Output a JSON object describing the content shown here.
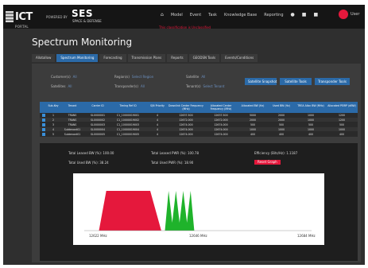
{
  "header": {
    "brand": "ICT",
    "brand_sub": "PORTAL",
    "powered_by": "POWERED BY",
    "ses": "SES",
    "ses_sub": "SPACE & DEFENSE",
    "nav": [
      {
        "label": "Home"
      },
      {
        "label": "Model"
      },
      {
        "label": "Event"
      },
      {
        "label": "Task"
      },
      {
        "label": "Knowledge Base"
      },
      {
        "label": "Reporting"
      }
    ],
    "user_label": "User",
    "banner": "This classification is Unclassified"
  },
  "page": {
    "title": "Spectrum Monitoring",
    "tabs": [
      {
        "label": "Allotallow"
      },
      {
        "label": "Spectrum Monitoring"
      },
      {
        "label": "Forecasting"
      },
      {
        "label": "Transmission Plans"
      },
      {
        "label": "Reports"
      },
      {
        "label": "GEODSN Tools"
      },
      {
        "label": "Events/Conditions"
      }
    ]
  },
  "filters": {
    "row1": [
      {
        "label": "Customer(s)",
        "value": "All"
      },
      {
        "label": "Region(s)",
        "value": "Select Region"
      },
      {
        "label": "Satellite",
        "value": "All"
      }
    ],
    "row2": [
      {
        "label": "Satellites",
        "value": "All"
      },
      {
        "label": "Transponder(s)",
        "value": "All"
      },
      {
        "label": "Tenant(s)",
        "value": "Select Tenant"
      }
    ],
    "buttons": [
      "Satellite Snapshot",
      "Satellite Tools",
      "Transponder Tools"
    ]
  },
  "table": {
    "columns": [
      "",
      "Sub-Key",
      "Tenant",
      "Carrier ID",
      "Timing Ref ID",
      "S/N Priority",
      "Downlink Center Frequency (MHz)",
      "Allocated Center Frequency (MHz)",
      "Allocated BW (Hz)",
      "Used BW (Hz)",
      "TREA Alloc BW (MHz)",
      "Allocated PEIRP (dBW)"
    ],
    "rows": [
      [
        "",
        "1",
        "TRANS",
        "SL0000001",
        "C1_10000019001",
        "4",
        "12637.500",
        "12637.500",
        "5000",
        "2000",
        "1000",
        "1200"
      ],
      [
        "",
        "2",
        "TRANS",
        "SL0000002",
        "C1_10000019002",
        "4",
        "12672.000",
        "12672.000",
        "2000",
        "2000",
        "1000",
        "1200"
      ],
      [
        "",
        "3",
        "TRANS",
        "SL0000003",
        "C1_10000019003",
        "4",
        "12674.000",
        "12674.000",
        "500",
        "500",
        "500",
        "500"
      ],
      [
        "",
        "4",
        "Subtenant01",
        "SL0000004",
        "C1_10000019004",
        "4",
        "12674.000",
        "12674.000",
        "1000",
        "1000",
        "1000",
        "1000"
      ],
      [
        "",
        "5",
        "Subtenant01",
        "SL0000005",
        "C1_10000019005",
        "4",
        "12674.000",
        "12674.000",
        "400",
        "400",
        "400",
        "400"
      ]
    ]
  },
  "stats": {
    "total_leased_bw": "Total Leased BW (%): 100.00",
    "total_leased_pwr": "Total Leased PWR (%): 100.78",
    "efficiency": "Efficiency (Bits/Hz): 1.1187",
    "total_used_bw": "Total Used BW (%): 38.24",
    "total_used_pwr": "Total Used PWR (%): 18.90",
    "reset_label": "Reset Graph"
  },
  "chart_data": {
    "type": "area",
    "xlabel": "",
    "ylabel": "",
    "x_ticks": [
      "12622 MHz",
      "12646 MHz",
      "12684 MHz"
    ],
    "series": [
      {
        "color": "#e5183c",
        "shape": "trapezoid",
        "x": [
          12626,
          12628,
          12640,
          12643
        ],
        "y": [
          0,
          1,
          1,
          0
        ]
      },
      {
        "color": "#1fb32b",
        "shape": "peaks",
        "x": [
          12644,
          12645,
          12646,
          12647,
          12648,
          12649,
          12650,
          12651,
          12652
        ],
        "y": [
          0,
          1,
          0.2,
          1,
          0.2,
          1,
          0.2,
          1,
          0
        ]
      }
    ],
    "colors": {
      "red": "#e5183c",
      "green": "#1fb32b"
    }
  },
  "colors": {
    "accent": "#2b6aa8",
    "danger": "#e5183c"
  }
}
